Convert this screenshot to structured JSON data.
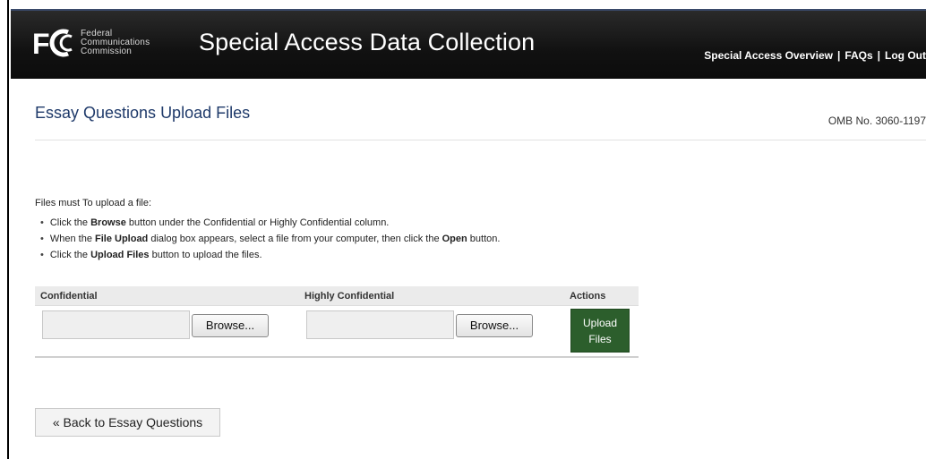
{
  "header": {
    "logo_lines": [
      "Federal",
      "Communications",
      "Commission"
    ],
    "app_title": "Special Access Data Collection",
    "nav": [
      {
        "label": "Special Access Overview"
      },
      {
        "label": "FAQs"
      },
      {
        "label": "Log Out"
      }
    ],
    "nav_separator": "|"
  },
  "page": {
    "title": "Essay Questions Upload Files",
    "omb": "OMB No. 3060-1197",
    "intro": "Files must To upload a file:",
    "instructions": [
      {
        "a": "Click the ",
        "b": "Browse",
        "c": " button under the Confidential or Highly Confidential column.",
        "d": "",
        "e": ""
      },
      {
        "a": "When the ",
        "b": "File Upload",
        "c": " dialog box appears, select a file from your computer, then click the ",
        "d": "Open",
        "e": " button."
      },
      {
        "a": "Click the ",
        "b": "Upload Files",
        "c": " button to upload the files.",
        "d": "",
        "e": ""
      }
    ]
  },
  "table": {
    "headers": {
      "confidential": "Confidential",
      "highly_confidential": "Highly Confidential",
      "actions": "Actions"
    },
    "browse_label": "Browse...",
    "upload_line1": "Upload",
    "upload_line2": "Files"
  },
  "back_button": "« Back to Essay Questions",
  "colors": {
    "header_bg": "#111111",
    "title_blue": "#1f3a6a",
    "upload_green": "#2c5e2c"
  }
}
